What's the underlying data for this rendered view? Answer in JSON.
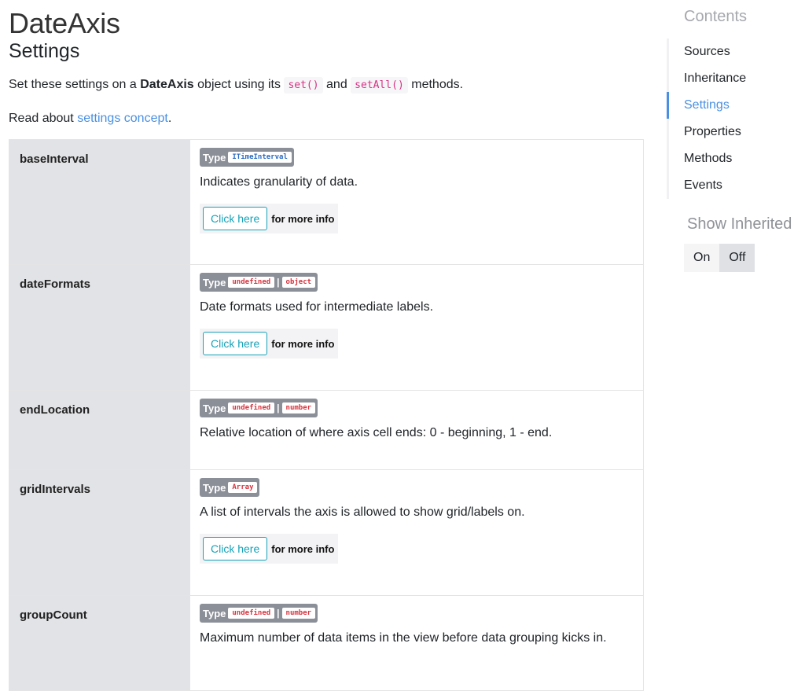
{
  "page": {
    "title": "DateAxis",
    "subtitle": "Settings",
    "intro": {
      "prefix": "Set these settings on a ",
      "class_name": "DateAxis",
      "middle": " object using its ",
      "method1": "set()",
      "and": " and ",
      "method2": "setAll()",
      "suffix": " methods."
    },
    "read": {
      "prefix": "Read about ",
      "link": "settings concept",
      "suffix": "."
    }
  },
  "settings": [
    {
      "name": "baseInterval",
      "type_label": "Type",
      "types": [
        "ITimeInterval"
      ],
      "description": "Indicates granularity of data.",
      "more_button": "Click here",
      "more_text": "for more info"
    },
    {
      "name": "dateFormats",
      "type_label": "Type",
      "types": [
        "undefined",
        "object"
      ],
      "description": "Date formats used for intermediate labels.",
      "more_button": "Click here",
      "more_text": "for more info"
    },
    {
      "name": "endLocation",
      "type_label": "Type",
      "types": [
        "undefined",
        "number"
      ],
      "description": "Relative location of where axis cell ends: 0 - beginning, 1 - end."
    },
    {
      "name": "gridIntervals",
      "type_label": "Type",
      "types": [
        "Array"
      ],
      "description": "A list of intervals the axis is allowed to show grid/labels on.",
      "more_button": "Click here",
      "more_text": "for more info"
    },
    {
      "name": "groupCount",
      "type_label": "Type",
      "types": [
        "undefined",
        "number"
      ],
      "description": "Maximum number of data items in the view before data grouping kicks in."
    }
  ],
  "type_separator": "|",
  "toc": {
    "title": "Contents",
    "items": [
      "Sources",
      "Inheritance",
      "Settings",
      "Properties",
      "Methods",
      "Events"
    ],
    "active": "Settings"
  },
  "inherited": {
    "title": "Show Inherited",
    "on": "On",
    "off": "Off"
  },
  "colors": {
    "link": "#4a90e2",
    "accent": "#17a2b8",
    "code": "#d6333e"
  }
}
